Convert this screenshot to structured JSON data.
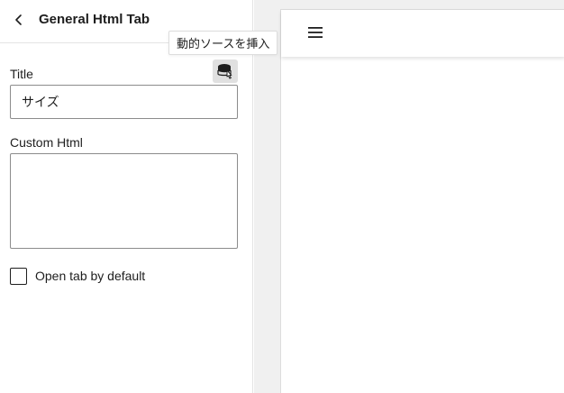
{
  "panel": {
    "title": "General Html Tab",
    "back_icon": "chevron-left-icon"
  },
  "fields": {
    "title_label": "Title",
    "title_value": "サイズ",
    "custom_html_label": "Custom Html",
    "custom_html_value": "",
    "dynamic_source_icon": "database-icon"
  },
  "checkbox": {
    "label": "Open tab by default",
    "checked": false
  },
  "tooltip": {
    "text": "動的ソースを挿入"
  },
  "preview": {
    "menu_icon": "hamburger-menu-icon"
  }
}
